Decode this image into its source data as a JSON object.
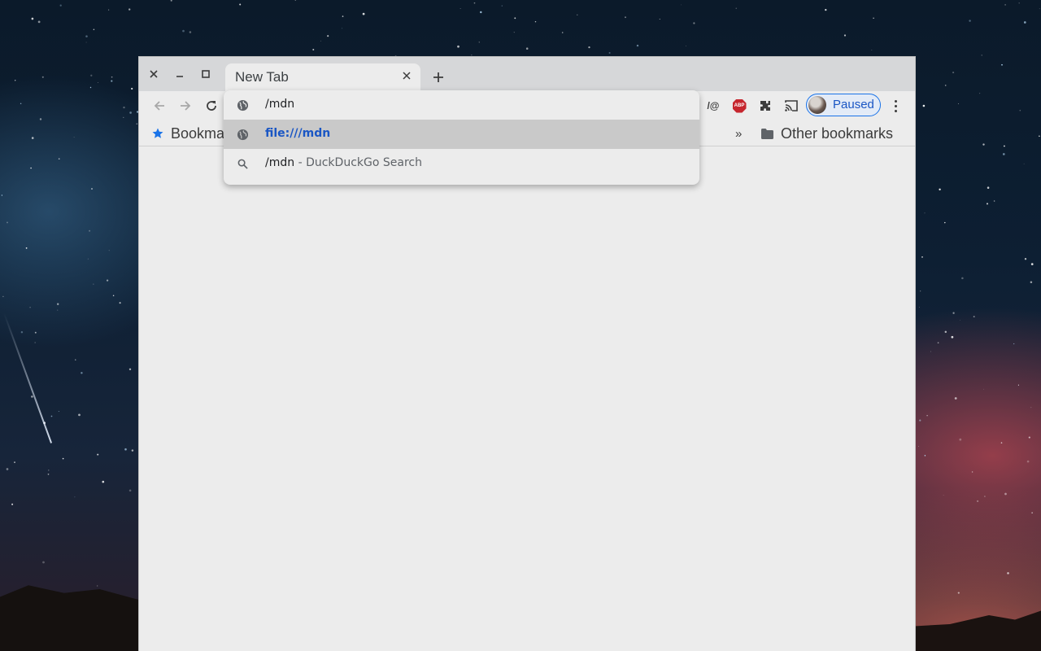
{
  "window": {
    "tab_title": "New Tab"
  },
  "omnibox": {
    "input_value": "/mdn",
    "suggestions": [
      {
        "type": "url",
        "text": "file:///mdn",
        "icon": "globe-icon",
        "selected": true
      },
      {
        "type": "search",
        "query": "/mdn",
        "separator": " - ",
        "engine_label": "DuckDuckGo Search",
        "icon": "search-icon",
        "selected": false
      }
    ]
  },
  "toolbar": {
    "extension_text": "/@",
    "abp_label": "ABP",
    "profile_status": "Paused"
  },
  "bookmarks": {
    "bookmarks_label": "Bookma",
    "overflow_label": "»",
    "other_bookmarks_label": "Other bookmarks"
  },
  "colors": {
    "accent_blue": "#1a73e8",
    "link_blue": "#1a56c4",
    "abp_red": "#c6262e",
    "window_bg": "#ececec",
    "titlebar_bg": "#d6d7d9"
  }
}
